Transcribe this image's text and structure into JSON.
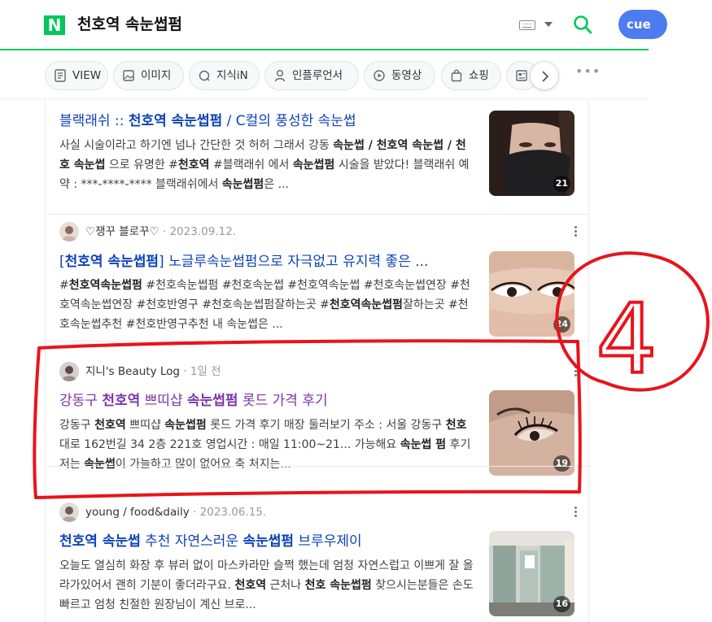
{
  "header": {
    "logo": "N",
    "query": "천호역 속눈썹펌",
    "profile_label": "cue"
  },
  "tabs": [
    {
      "label": "VIEW",
      "icon": "view-doc-icon"
    },
    {
      "label": "이미지",
      "icon": "image-icon"
    },
    {
      "label": "지식iN",
      "icon": "qna-icon"
    },
    {
      "label": "인플루언서",
      "icon": "person-icon"
    },
    {
      "label": "동영상",
      "icon": "play-icon"
    },
    {
      "label": "쇼핑",
      "icon": "bag-icon"
    },
    {
      "label": "",
      "icon": "news-icon"
    }
  ],
  "results": [
    {
      "title_parts": [
        "블랙래쉬 :: ",
        "천호역 속눈썹펌",
        " / C컬의 풍성한 속눈썹"
      ],
      "desc_html": "사실 시술이라고 하기엔 넘나 간단한 것 허허 그래서 강동 <b>속눈썹 / 천호역 속눈썹 / 천호 속눈썹</b> 으로 유명한 #<b>천호역</b> #블랙래쉬 에서 <b>속눈썹펌</b> 시술을 받았다! 블랙래쉬 예약 : ***-****-**** 블랙래쉬에서 <b>속눈썹펌</b>은 ...",
      "thumb_count": "21"
    },
    {
      "author": "♡쟁꾸 블로꾸♡",
      "date": " · 2023.09.12.",
      "title_parts": [
        "[",
        "천호역 속눈썹펌",
        "] 노글루속눈썹펌으로 자극없고 유지력 좋은 ..."
      ],
      "desc_html": "#<b>천호역속눈썹펌</b> #천호속눈썹펌 #천호속눈썹 #천호역속눈썹 #천호속눈썹연장 #천호역속눈썹연장 #천호반영구 #천호속눈썹펌잘하는곳 #<b>천호역속눈썹펌</b>잘하는곳 #천호속눈썹추천 #천호반영구추천 내 속눈썹은 ...",
      "thumb_count": "24"
    },
    {
      "author": "지니's Beauty Log",
      "date": " · 1일 전",
      "title_parts": [
        "강동구 ",
        "천호역",
        " 쁘띠샵 ",
        "속눈썹펌",
        " 롯드 가격 후기"
      ],
      "desc_html": "강동구 <b>천호역</b> 쁘띠샵 <b>속눈썹펌</b> 롯드 가격 후기 매장 둘러보기 주소 : 서울 강동구 <b>천호</b>대로 162번길 34 2층 221호 영업시간 : 매일 11:00~21... 가능해요 <b>속눈썹 펌</b> 후기 저는 <b>속눈썹</b>이 가늘하고 많이 없어요 축 처지는...",
      "thumb_count": "19"
    },
    {
      "author": "young / food&daily",
      "date": " · 2023.06.15.",
      "title_parts": [
        "천호역 속눈썹",
        " 추천 자연스러운 ",
        "속눈썹펌",
        " 브루우제이"
      ],
      "desc_html": "오늘도 열심히 화장 후 뷰러 없이 마스카라만 슬쩍 했는데 엄청 자연스럽고 이쁘게 잘 올라가있어서 괜히 기분이 좋더라구요. <b>천호역</b> 근처나 <b>천호 속눈썹펌</b> 찾으시는분들은 손도 빠르고 엄청 친절한 원장님이 계신 브로...",
      "thumb_count": "16"
    }
  ],
  "annotation": {
    "label": "4",
    "color": "#e8141c"
  }
}
